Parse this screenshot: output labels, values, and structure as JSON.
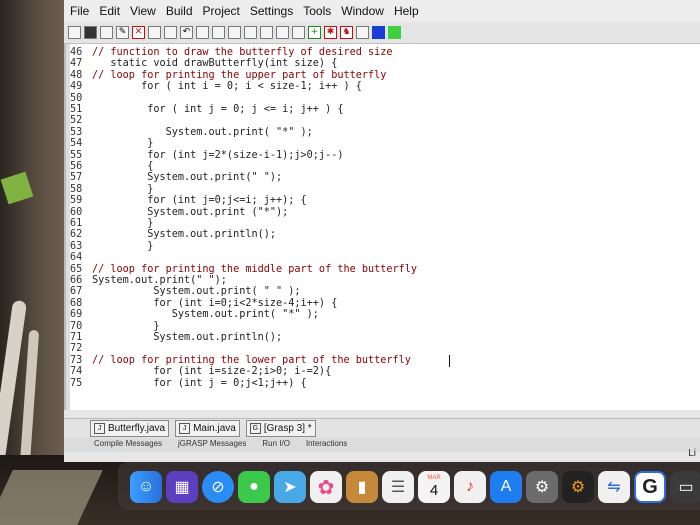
{
  "menubar": {
    "items": [
      "File",
      "Edit",
      "View",
      "Build",
      "Project",
      "Settings",
      "Tools",
      "Window",
      "Help"
    ]
  },
  "editor": {
    "lines": [
      {
        "n": "46",
        "t": "// function to draw the butterfly of desired size"
      },
      {
        "n": "47",
        "t": "   static void drawButterfly(int size) {"
      },
      {
        "n": "48",
        "t": "// loop for printing the upper part of butterfly"
      },
      {
        "n": "49",
        "t": "        for ( int i = 0; i < size-1; i++ ) {"
      },
      {
        "n": "50",
        "t": ""
      },
      {
        "n": "51",
        "t": "         for ( int j = 0; j <= i; j++ ) {"
      },
      {
        "n": "52",
        "t": ""
      },
      {
        "n": "53",
        "t": "            System.out.print( \"*\" );"
      },
      {
        "n": "54",
        "t": "         }"
      },
      {
        "n": "55",
        "t": "         for (int j=2*(size-i-1);j>0;j--)"
      },
      {
        "n": "56",
        "t": "         {"
      },
      {
        "n": "57",
        "t": "         System.out.print(\" \");"
      },
      {
        "n": "58",
        "t": "         }"
      },
      {
        "n": "59",
        "t": "         for (int j=0;j<=i; j++); {"
      },
      {
        "n": "60",
        "t": "         System.out.print (\"*\");"
      },
      {
        "n": "61",
        "t": "         }"
      },
      {
        "n": "62",
        "t": "         System.out.println();"
      },
      {
        "n": "63",
        "t": "         }"
      },
      {
        "n": "64",
        "t": ""
      },
      {
        "n": "65",
        "t": "// loop for printing the middle part of the butterfly"
      },
      {
        "n": "66",
        "t": "System.out.print(\" \");"
      },
      {
        "n": "67",
        "t": "          System.out.print( \" \" );"
      },
      {
        "n": "68",
        "t": "          for (int i=0;i<2*size-4;i++) {"
      },
      {
        "n": "69",
        "t": "             System.out.print( \"*\" );"
      },
      {
        "n": "70",
        "t": "          }"
      },
      {
        "n": "71",
        "t": "          System.out.println();"
      },
      {
        "n": "72",
        "t": ""
      },
      {
        "n": "73",
        "t": "// loop for printing the lower part of the butterfly"
      },
      {
        "n": "74",
        "t": "          for (int i=size-2;i>0; i-=2){"
      },
      {
        "n": "75",
        "t": "          for (int j = 0;j<1;j++) {"
      }
    ]
  },
  "tabs": [
    {
      "label": "Butterfly.java"
    },
    {
      "label": "Main.java"
    },
    {
      "label": "[Grasp 3]"
    }
  ],
  "message_tabs": [
    "Compile Messages",
    "jGRASP Messages",
    "Run I/O",
    "Interactions"
  ],
  "status": {
    "li": "Li"
  },
  "dock": {
    "calendar_month": "MAR",
    "calendar_day": "4",
    "g_label": "G"
  }
}
